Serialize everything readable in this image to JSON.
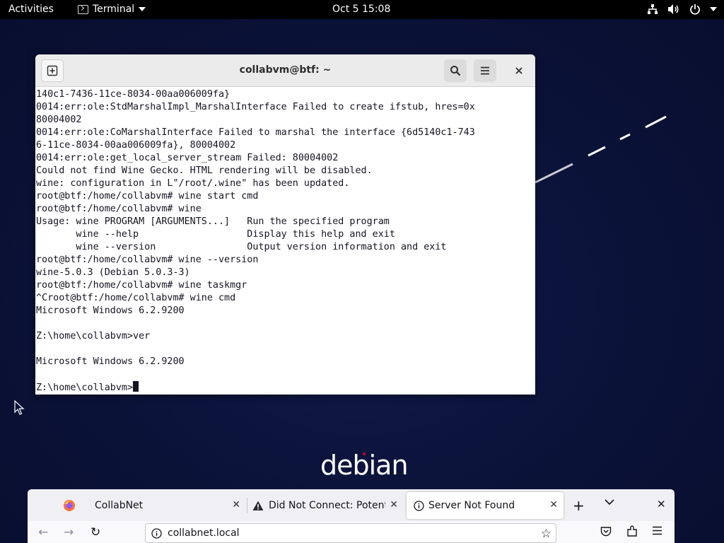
{
  "topbar": {
    "activities": "Activities",
    "app_name": "Terminal",
    "clock": "Oct 5  15:08"
  },
  "terminal": {
    "title": "collabvm@btf: ~",
    "lines": [
      "140c1-7436-11ce-8034-00aa006009fa}",
      "0014:err:ole:StdMarshalImpl_MarshalInterface Failed to create ifstub, hres=0x",
      "80004002",
      "0014:err:ole:CoMarshalInterface Failed to marshal the interface {6d5140c1-743",
      "6-11ce-8034-00aa006009fa}, 80004002",
      "0014:err:ole:get_local_server_stream Failed: 80004002",
      "Could not find Wine Gecko. HTML rendering will be disabled.",
      "wine: configuration in L\"/root/.wine\" has been updated.",
      "root@btf:/home/collabvm# wine start cmd",
      "root@btf:/home/collabvm# wine",
      "Usage: wine PROGRAM [ARGUMENTS...]   Run the specified program",
      "       wine --help                   Display this help and exit",
      "       wine --version                Output version information and exit",
      "root@btf:/home/collabvm# wine --version",
      "wine-5.0.3 (Debian 5.0.3-3)",
      "root@btf:/home/collabvm# wine taskmgr",
      "^Croot@btf:/home/collabvm# wine cmd",
      "Microsoft Windows 6.2.9200",
      "",
      "Z:\\home\\collabvm>ver",
      "",
      "Microsoft Windows 6.2.9200",
      ""
    ],
    "prompt": "Z:\\home\\collabvm>"
  },
  "desktop": {
    "logo_text": "debian"
  },
  "firefox": {
    "tabs": [
      {
        "label": "CollabNet",
        "icon": "none"
      },
      {
        "label": "Did Not Connect: Potenti",
        "icon": "warning-icon"
      },
      {
        "label": "Server Not Found",
        "icon": "info-icon"
      }
    ],
    "url": "collabnet.local"
  },
  "colors": {
    "desktop_bg": "#0b1238",
    "terminal_bg": "#ffffff",
    "terminal_fg": "#171421",
    "debian_red": "#c70036"
  }
}
